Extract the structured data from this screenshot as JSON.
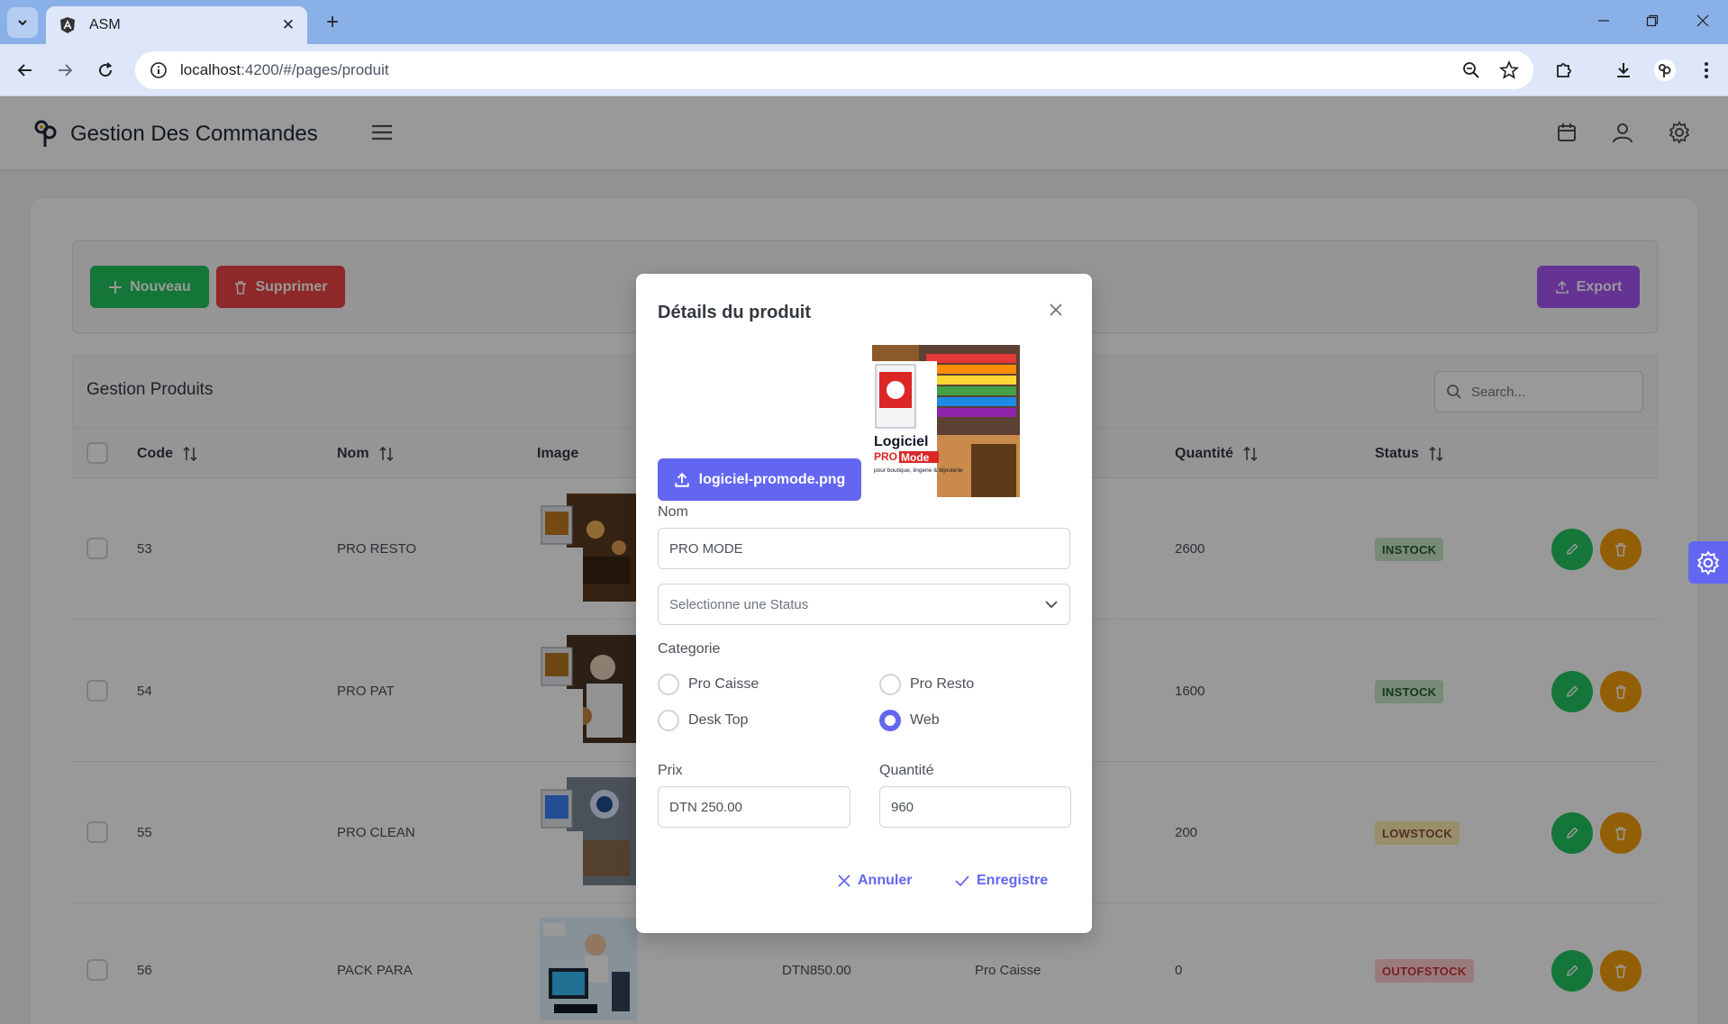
{
  "browser": {
    "tab_title": "ASM",
    "url_host": "localhost",
    "url_rest": ":4200/#/pages/produit"
  },
  "app": {
    "title": "Gestion Des Commandes"
  },
  "toolbar": {
    "new_label": "Nouveau",
    "delete_label": "Supprimer",
    "export_label": "Export"
  },
  "table": {
    "title": "Gestion Produits",
    "search_placeholder": "Search...",
    "columns": {
      "code": "Code",
      "name": "Nom",
      "image": "Image",
      "quantity": "Quantité",
      "status": "Status"
    },
    "rows": [
      {
        "code": "53",
        "name": "PRO RESTO",
        "price": "",
        "category": "",
        "quantity": "2600",
        "status": "INSTOCK"
      },
      {
        "code": "54",
        "name": "PRO PAT",
        "price": "",
        "category": "",
        "quantity": "1600",
        "status": "INSTOCK"
      },
      {
        "code": "55",
        "name": "PRO CLEAN",
        "price": "",
        "category": "",
        "quantity": "200",
        "status": "LOWSTOCK"
      },
      {
        "code": "56",
        "name": "PACK PARA",
        "price": "DTN850.00",
        "category": "Pro Caisse",
        "quantity": "0",
        "status": "OUTOFSTOCK"
      }
    ]
  },
  "dialog": {
    "title": "Détails du produit",
    "upload_label": "logiciel-promode.png",
    "preview": {
      "brand": "Logiciel",
      "pro": "PRO",
      "mode": "Mode",
      "tagline": "pour boutique, lingerie & bijouterie"
    },
    "name_label": "Nom",
    "name_value": "PRO MODE",
    "status_placeholder": "Selectionne une Status",
    "category_label": "Categorie",
    "categories": [
      "Pro Caisse",
      "Pro Resto",
      "Desk Top",
      "Web"
    ],
    "selected_category": "Web",
    "price_label": "Prix",
    "price_value": "DTN 250.00",
    "quantity_label": "Quantité",
    "quantity_value": "960",
    "cancel_label": "Annuler",
    "save_label": "Enregistre"
  },
  "colors": {
    "primary": "#6366f1",
    "success": "#22c55e",
    "danger": "#ef4444",
    "help": "#a855f7",
    "warning": "#f59e0b"
  }
}
